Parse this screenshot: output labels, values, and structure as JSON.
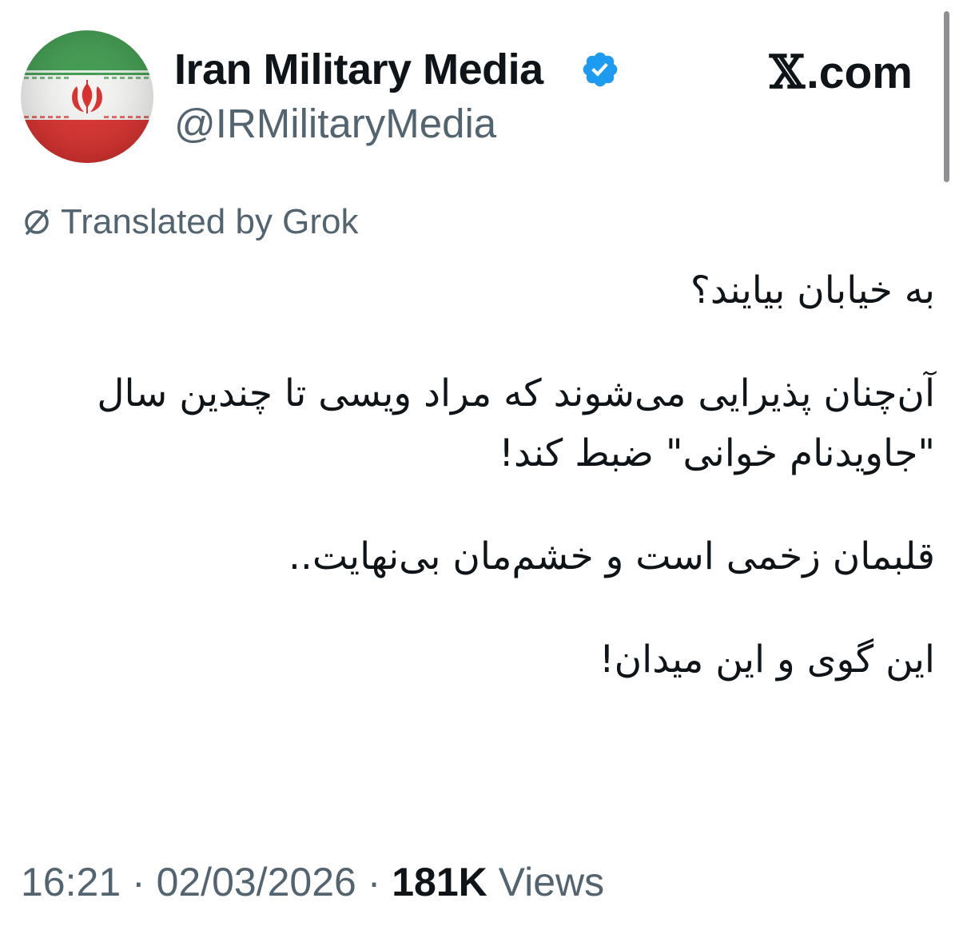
{
  "author": {
    "display_name": "Iran Military Media",
    "handle": "@IRMilitaryMedia",
    "verified_icon": "verified-badge-icon",
    "avatar": "iran-flag-avatar"
  },
  "brand": {
    "x_letter": "𝕏",
    "domain": ".com"
  },
  "translation": {
    "icon": "grok-icon",
    "label": "Translated by Grok"
  },
  "tweet": {
    "paragraphs": [
      "به خیابان بیایند؟",
      "آن‌چنان پذیرایی می‌شوند که مراد ویسی تا چندین سال \"جاویدنام خوانی\" ضبط کند!",
      "قلبمان زخمی است و خشم‌مان بی‌نهایت..",
      "این گوی و این میدان!"
    ]
  },
  "meta": {
    "time": "16:21",
    "separator": " · ",
    "date": "02/03/2026",
    "views_count": "181K",
    "views_label": " Views"
  },
  "colors": {
    "text": "#0f1419",
    "secondary": "#536471",
    "verified": "#1d9bf0",
    "flag_green": "#3f9a4e",
    "flag_red": "#d92f2c"
  }
}
